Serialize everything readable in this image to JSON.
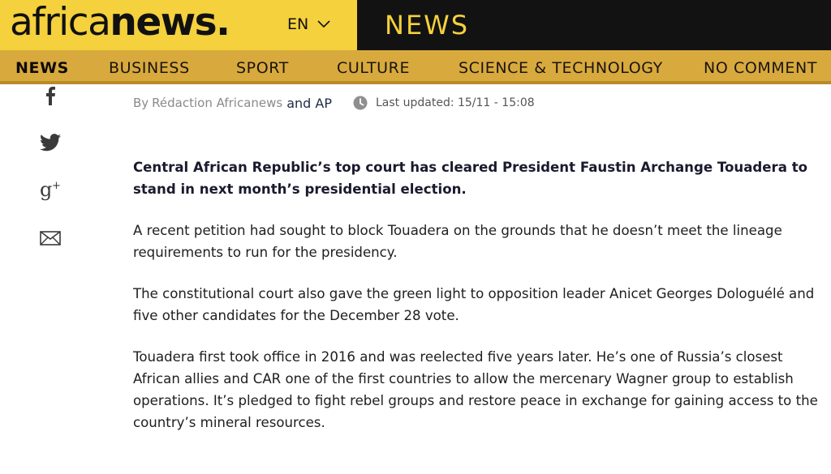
{
  "colors": {
    "brand_yellow": "#f4d13d",
    "nav_gold": "#d8a93d",
    "header_dark": "#121212"
  },
  "header": {
    "logo_light": "africa",
    "logo_bold": "news.",
    "language": "EN",
    "section_title": "NEWS"
  },
  "nav": {
    "items": [
      {
        "label": "NEWS",
        "active": true
      },
      {
        "label": "BUSINESS"
      },
      {
        "label": "SPORT"
      },
      {
        "label": "CULTURE"
      },
      {
        "label": "SCIENCE & TECHNOLOGY"
      },
      {
        "label": "NO COMMENT"
      }
    ]
  },
  "share": {
    "icons": [
      "facebook-icon",
      "twitter-icon",
      "google-plus-icon",
      "email-icon"
    ]
  },
  "byline": {
    "by": "By",
    "authors": "Rédaction Africanews",
    "and_ap": "and AP",
    "updated": "Last updated: 15/11 - 15:08"
  },
  "article": {
    "paragraphs": [
      "Central African Republic’s top court has cleared President Faustin Archange Touadera to stand in next month’s presidential election.",
      "A recent petition had sought to block Touadera on the grounds that he doesn’t meet the lineage requirements to run for the presidency.",
      "The constitutional court also gave the green light to opposition leader Anicet Georges Dologuélé and five other candidates for the December 28 vote.",
      "Touadera first took office in 2016 and was reelected five years later. He’s one of Russia’s closest African allies and CAR one of the first countries to allow the mercenary Wagner group to establish operations. It’s pledged to fight rebel groups and restore peace in exchange for gaining access to the country’s mineral resources."
    ]
  }
}
